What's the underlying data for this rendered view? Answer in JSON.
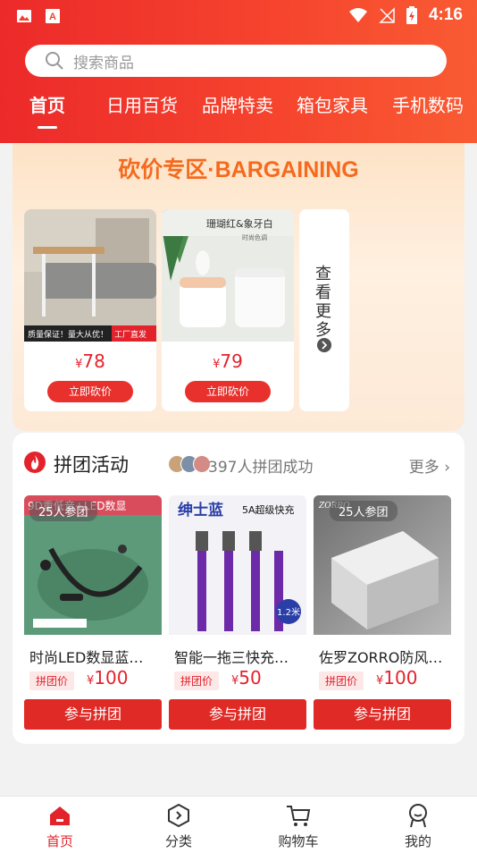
{
  "status_bar": {
    "time": "4:16"
  },
  "search": {
    "placeholder": "搜索商品"
  },
  "tabs": [
    {
      "label": "首页",
      "active": true
    },
    {
      "label": "日用百货"
    },
    {
      "label": "品牌特卖"
    },
    {
      "label": "箱包家具"
    },
    {
      "label": "手机数码"
    }
  ],
  "bargain": {
    "title": "砍价专区·BARGAINING",
    "items": [
      {
        "banner_left": "质量保证！量大从优！",
        "banner_right": "工厂直发",
        "price_symbol": "¥",
        "price": "78",
        "button": "立即砍价"
      },
      {
        "img_text": "珊瑚红&象牙白",
        "img_subtext": "时尚色调",
        "price_symbol": "¥",
        "price": "79",
        "button": "立即砍价"
      }
    ],
    "more_label": "查看更多"
  },
  "group": {
    "title": "拼团活动",
    "success_text": "397人拼团成功",
    "more_label": "更多",
    "items": [
      {
        "people": "25人参团",
        "img_text": "9D重低音+LED数显",
        "name": "时尚LED数显蓝…",
        "tag": "拼团价",
        "price_symbol": "¥",
        "price": "100",
        "button": "参与拼团"
      },
      {
        "brand": "绅士蓝",
        "img_text": "5A超级快充",
        "badge": "1.2米",
        "name": "智能一拖三快充…",
        "tag": "拼团价",
        "price_symbol": "¥",
        "price": "50",
        "button": "参与拼团"
      },
      {
        "people": "25人参团",
        "brand": "ZORRO",
        "name": "佐罗ZORRO防风…",
        "tag": "拼团价",
        "price_symbol": "¥",
        "price": "100",
        "button": "参与拼团"
      }
    ]
  },
  "bottom_nav": [
    {
      "label": "首页",
      "icon": "home-icon",
      "active": true
    },
    {
      "label": "分类",
      "icon": "category-icon"
    },
    {
      "label": "购物车",
      "icon": "cart-icon"
    },
    {
      "label": "我的",
      "icon": "profile-icon"
    }
  ],
  "colors": {
    "primary": "#e8302c",
    "accent_orange": "#f56a1e",
    "bargain_bg": "#fde3c6"
  }
}
